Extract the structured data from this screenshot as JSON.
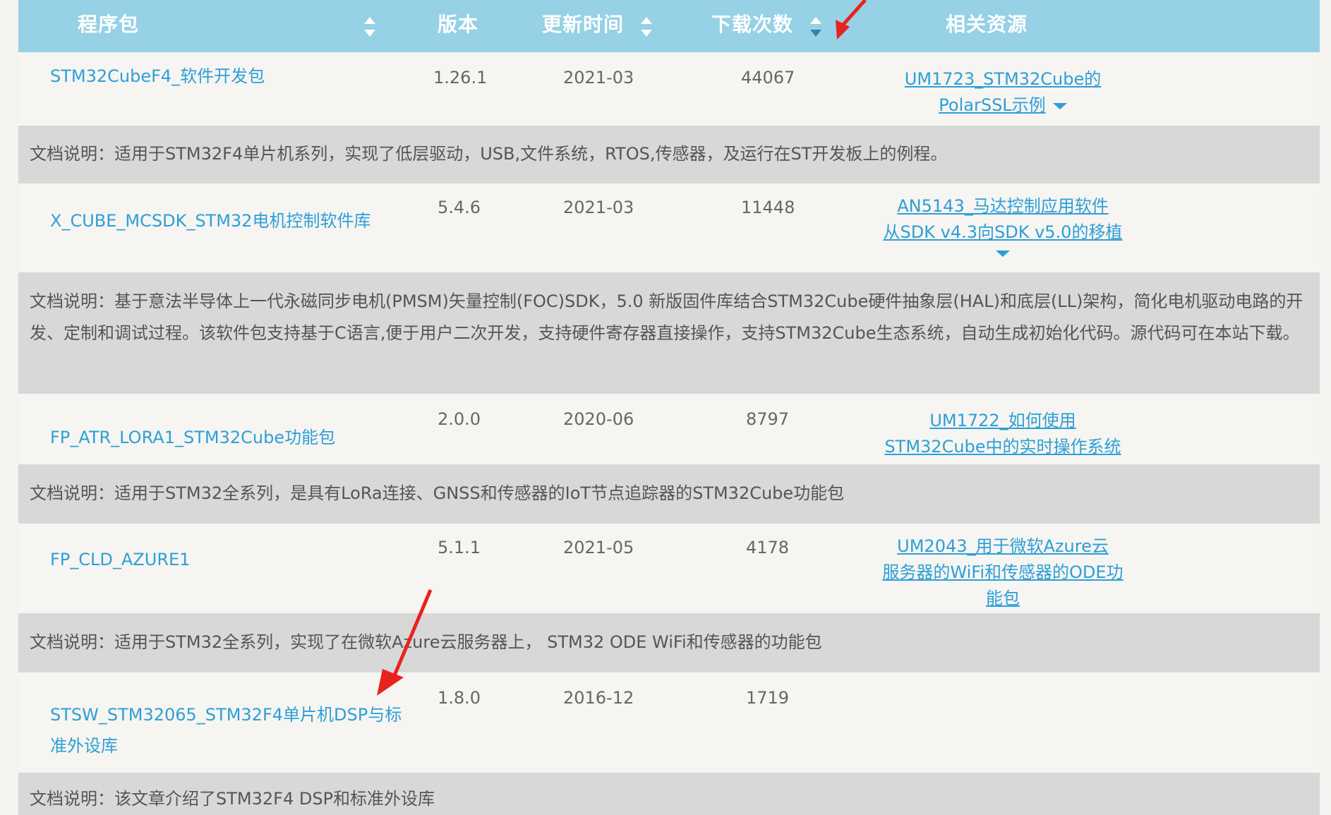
{
  "header": {
    "col_package": "程序包",
    "col_version": "版本",
    "col_updated": "更新时间",
    "col_downloads": "下载次数",
    "col_resources": "相关资源"
  },
  "desc_prefix": "文档说明：",
  "rows": [
    {
      "package_lines": [
        "STM32CubeF4_软件开发包"
      ],
      "version": "1.26.1",
      "updated": "2021-03",
      "downloads": "44067",
      "resource_lines": [
        "UM1723_STM32Cube的",
        "PolarSSL示例"
      ],
      "description": "适用于STM32F4单片机系列，实现了低层驱动，USB,文件系统，RTOS,传感器，及运行在ST开发板上的例程。"
    },
    {
      "package_lines": [
        "X_CUBE_MCSDK_STM32电机控制软件库"
      ],
      "version": "5.4.6",
      "updated": "2021-03",
      "downloads": "11448",
      "resource_lines": [
        "AN5143_马达控制应用软件",
        "从SDK v4.3向SDK v5.0的移植"
      ],
      "description": "基于意法半导体上一代永磁同步电机(PMSM)矢量控制(FOC)SDK，5.0 新版固件库结合STM32Cube硬件抽象层(HAL)和底层(LL)架构，简化电机驱动电路的开发、定制和调试过程。该软件包支持基于C语言,便于用户二次开发，支持硬件寄存器直接操作，支持STM32Cube生态系统，自动生成初始化代码。源代码可在本站下载。"
    },
    {
      "package_lines": [
        "FP_ATR_LORA1_STM32Cube功能包"
      ],
      "version": "2.0.0",
      "updated": "2020-06",
      "downloads": "8797",
      "resource_lines": [
        "UM1722_如何使用",
        "STM32Cube中的实时操作系统"
      ],
      "description": "适用于STM32全系列，是具有LoRa连接、GNSS和传感器的IoT节点追踪器的STM32Cube功能包"
    },
    {
      "package_lines": [
        "FP_CLD_AZURE1"
      ],
      "version": "5.1.1",
      "updated": "2021-05",
      "downloads": "4178",
      "resource_lines": [
        "UM2043_用于微软Azure云",
        "服务器的WiFi和传感器的ODE功",
        "能包"
      ],
      "description": "适用于STM32全系列，实现了在微软Azure云服务器上， STM32 ODE WiFi和传感器的功能包"
    },
    {
      "package_lines": [
        "STSW_STM32065_STM32F4单片机DSP与标",
        "准外设库"
      ],
      "version": "1.8.0",
      "updated": "2016-12",
      "downloads": "1719",
      "resource_lines": [],
      "description": "该文章介绍了STM32F4 DSP和标准外设库"
    }
  ]
}
